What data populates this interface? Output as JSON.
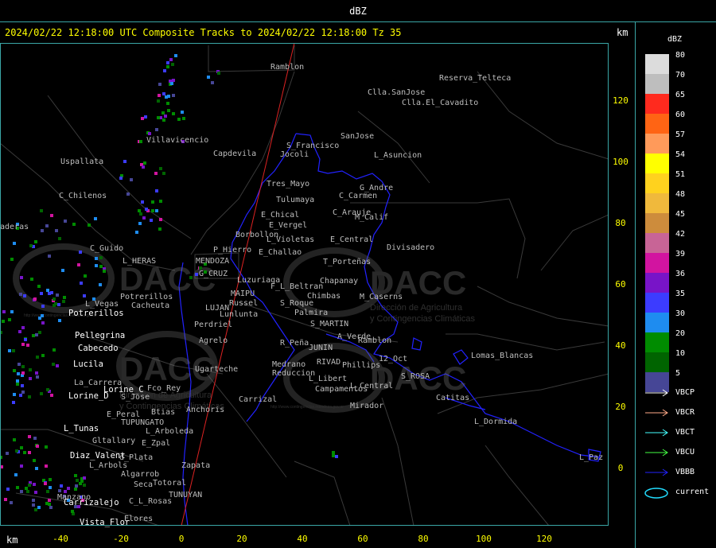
{
  "window_title": "dBZ",
  "header": {
    "text": "2024/02/22 12:18:00 UTC Composite Tracks to 2024/02/22 12:18:00 Tz 35",
    "km_top": "km",
    "km_bottom": "km"
  },
  "y_axis": {
    "ticks": [
      {
        "label": "120",
        "value": 120
      },
      {
        "label": "100",
        "value": 100
      },
      {
        "label": "80",
        "value": 80
      },
      {
        "label": "60",
        "value": 60
      },
      {
        "label": "40",
        "value": 40
      },
      {
        "label": "20",
        "value": 20
      },
      {
        "label": "0",
        "value": 0
      }
    ]
  },
  "x_axis": {
    "ticks": [
      {
        "label": "-40",
        "value": -40
      },
      {
        "label": "-20",
        "value": -20
      },
      {
        "label": "0",
        "value": 0
      },
      {
        "label": "20",
        "value": 20
      },
      {
        "label": "40",
        "value": 40
      },
      {
        "label": "60",
        "value": 60
      },
      {
        "label": "80",
        "value": 80
      },
      {
        "label": "100",
        "value": 100
      },
      {
        "label": "120",
        "value": 120
      }
    ]
  },
  "legend": {
    "title": "dBZ",
    "scale": [
      {
        "label": "80",
        "color": "#dcdcdc"
      },
      {
        "label": "70",
        "color": "#bebebe"
      },
      {
        "label": "65",
        "color": "#ff2a1e"
      },
      {
        "label": "60",
        "color": "#ff6414"
      },
      {
        "label": "57",
        "color": "#ff9a5a"
      },
      {
        "label": "54",
        "color": "#ffff00"
      },
      {
        "label": "51",
        "color": "#ffd21e"
      },
      {
        "label": "48",
        "color": "#f0b93c"
      },
      {
        "label": "45",
        "color": "#cd8c3c"
      },
      {
        "label": "42",
        "color": "#c86496"
      },
      {
        "label": "39",
        "color": "#d214a0"
      },
      {
        "label": "36",
        "color": "#7814c8"
      },
      {
        "label": "35",
        "color": "#3c3cff"
      },
      {
        "label": "30",
        "color": "#1e8cf0"
      },
      {
        "label": "20",
        "color": "#008c00"
      },
      {
        "label": "10",
        "color": "#006400"
      },
      {
        "label": "5",
        "color": "#464696"
      }
    ],
    "tracks": [
      {
        "label": "VBCP",
        "color": "#ffffff"
      },
      {
        "label": "VBCR",
        "color": "#ffaa88"
      },
      {
        "label": "VBCT",
        "color": "#44ffff"
      },
      {
        "label": "VBCU",
        "color": "#44ff44"
      },
      {
        "label": "VBBB",
        "color": "#2222ff"
      },
      {
        "label": "current",
        "color": "#22ddff"
      }
    ]
  },
  "watermark": {
    "brand": "DACC",
    "line1": "Dirección de Agricultura",
    "line2": "y Contingencias Climáticas",
    "url": "http://www.contingencias.mendoza.gov.ar"
  },
  "places_gray": [
    "Ramblon",
    "Reserva_Telteca",
    "Clla.SanJose",
    "Clla.El_Cavadito",
    "SanJose",
    "S_Francisco",
    "Jocoli",
    "L_Asuncion",
    "Villavicencio",
    "Capdevila",
    "Uspallata",
    "C_Chilenos",
    "Tres_Mayo",
    "G_Andre",
    "C_Carmen",
    "Tulumaya",
    "E_Chical",
    "C_Arauje",
    "M_Calif",
    "E_Vergel",
    "Borbollon",
    "L_Violetas",
    "E_Central",
    "Divisadero",
    "aderas",
    "C_Guido",
    "L_HERAS",
    "P_Hierro",
    "E_Challao",
    "MENDOZA",
    "T_Porteñas",
    "G_CRUZ",
    "Luzuriaga",
    "F_L_Beltran",
    "Chapanay",
    "MAIPU",
    "Chimbas",
    "M_Caserns",
    "Potrerillos",
    "L_Vegas",
    "Cacheuta",
    "LUJAN",
    "Russel",
    "S_Roque",
    "Palmira",
    "Lunlunta",
    "Perdriel",
    "S_MARTIN",
    "Agrelo",
    "R_Peña",
    "JUNIN",
    "A_Verde",
    "Ramblon",
    "Lomas_Blancas",
    "Ugarteche",
    "RIVAD",
    "12_Oct",
    "Medrano",
    "Phillips",
    "Reduccion",
    "L_Libert",
    "S_ROSA",
    "La_Carrera",
    "L_Central",
    "Campamentos",
    "Fco_Rey",
    "Carrizal",
    "Catitas",
    "S_Jose",
    "E_Peral",
    "Btias",
    "Anchoris",
    "Mirador",
    "TUPUNGATO",
    "L_Dormida",
    "L_Arboleda",
    "Gltallary",
    "E_Zpal",
    "d_Plata",
    "L_Paz",
    "L_Arbols",
    "Zapata",
    "Algarrob",
    "Seca",
    "Totoral",
    "Manzano",
    "C_L_Rosas",
    "TUNUYAN",
    "Elores"
  ],
  "places_white": [
    "Potrerillos",
    "Pellegrina",
    "Cabecedo",
    "Lucila",
    "Lorine_D",
    "Lorine_C",
    "L_Tunas",
    "Diaz_Valent",
    "Carrizalejo",
    "Vista_Flor"
  ]
}
